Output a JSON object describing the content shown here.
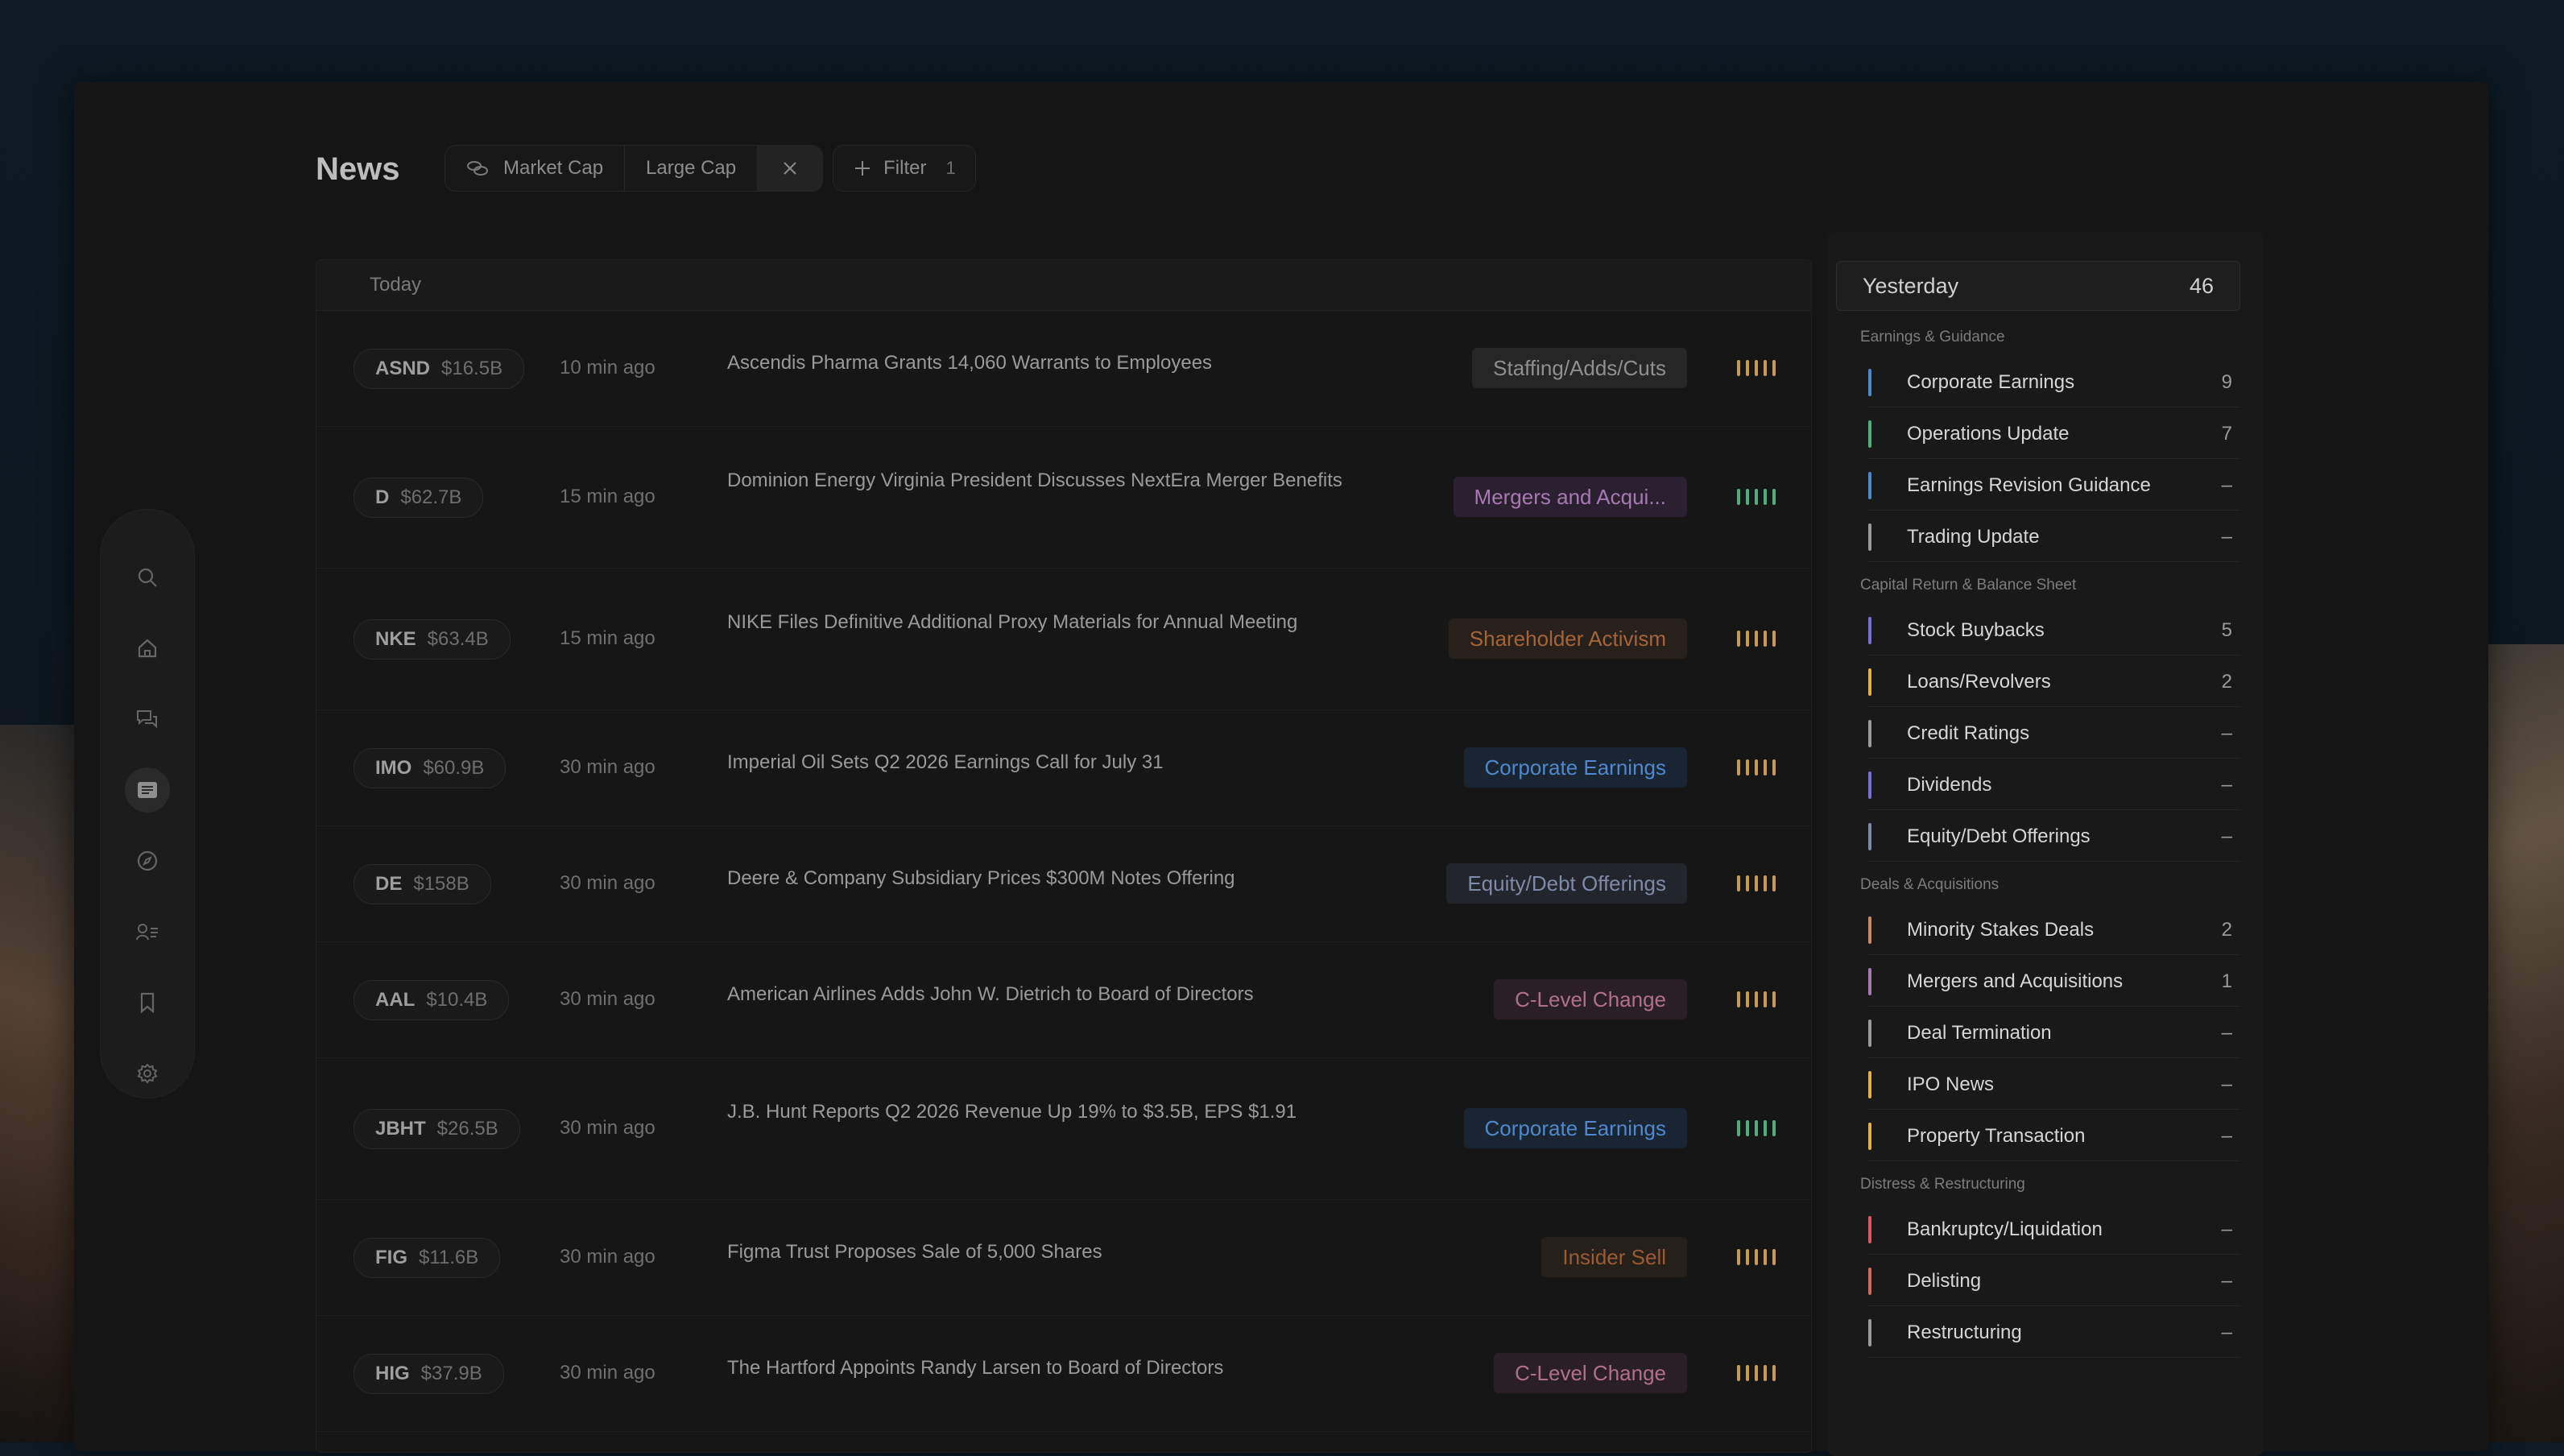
{
  "header": {
    "title": "News",
    "filter_chip": {
      "field": "Market Cap",
      "value": "Large Cap"
    },
    "filter_button": {
      "label": "Filter",
      "count": "1"
    }
  },
  "list": {
    "group_label": "Today",
    "rows": [
      {
        "ticker": "ASND",
        "cap": "$16.5B",
        "time": "10 min ago",
        "headline": "Ascendis Pharma Grants 14,060 Warrants to Employees",
        "tag": "Staffing/Adds/Cuts",
        "tag_color": "#8f8f8f",
        "tag_bg": "#262626",
        "bar_color": "#c99a4e"
      },
      {
        "ticker": "D",
        "cap": "$62.7B",
        "time": "15 min ago",
        "headline": "Dominion Energy Virginia President Discusses NextEra Merger Benefits",
        "tag": "Mergers and Acqui...",
        "tag_color": "#a67ab0",
        "tag_bg": "#2a2030",
        "bar_color": "#4fae7d"
      },
      {
        "ticker": "NKE",
        "cap": "$63.4B",
        "time": "15 min ago",
        "headline": "NIKE Files Definitive Additional Proxy Materials for Annual Meeting",
        "tag": "Shareholder Activism",
        "tag_color": "#a4643a",
        "tag_bg": "#28201a",
        "bar_color": "#c99a4e"
      },
      {
        "ticker": "IMO",
        "cap": "$60.9B",
        "time": "30 min ago",
        "headline": "Imperial Oil Sets Q2 2026 Earnings Call for July 31",
        "tag": "Corporate Earnings",
        "tag_color": "#4f88cc",
        "tag_bg": "#1a2533",
        "bar_color": "#c99a4e"
      },
      {
        "ticker": "DE",
        "cap": "$158B",
        "time": "30 min ago",
        "headline": "Deere & Company Subsidiary Prices $300M Notes Offering",
        "tag": "Equity/Debt Offerings",
        "tag_color": "#7f8aa6",
        "tag_bg": "#22252c",
        "bar_color": "#c99a4e"
      },
      {
        "ticker": "AAL",
        "cap": "$10.4B",
        "time": "30 min ago",
        "headline": "American Airlines Adds John W. Dietrich to Board of Directors",
        "tag": "C-Level Change",
        "tag_color": "#b0708c",
        "tag_bg": "#2a1f25",
        "bar_color": "#c99a4e"
      },
      {
        "ticker": "JBHT",
        "cap": "$26.5B",
        "time": "30 min ago",
        "headline": "J.B. Hunt Reports Q2 2026 Revenue Up 19% to $3.5B, EPS $1.91",
        "tag": "Corporate Earnings",
        "tag_color": "#4f88cc",
        "tag_bg": "#1a2533",
        "bar_color": "#4fae7d"
      },
      {
        "ticker": "FIG",
        "cap": "$11.6B",
        "time": "30 min ago",
        "headline": "Figma Trust Proposes Sale of 5,000 Shares",
        "tag": "Insider Sell",
        "tag_color": "#9a5a36",
        "tag_bg": "#26201a",
        "bar_color": "#c99a4e"
      },
      {
        "ticker": "HIG",
        "cap": "$37.9B",
        "time": "30 min ago",
        "headline": "The Hartford Appoints Randy Larsen to Board of Directors",
        "tag": "C-Level Change",
        "tag_color": "#b0708c",
        "tag_bg": "#2a1f25",
        "bar_color": "#c99a4e"
      }
    ]
  },
  "panel": {
    "title": "Yesterday",
    "total": "46",
    "sections": [
      {
        "label": "Earnings & Guidance",
        "items": [
          {
            "label": "Corporate Earnings",
            "count": "9",
            "color": "#4f88cc"
          },
          {
            "label": "Operations Update",
            "count": "7",
            "color": "#4fae7d"
          },
          {
            "label": "Earnings Revision Guidance",
            "count": "–",
            "color": "#4f88cc"
          },
          {
            "label": "Trading Update",
            "count": "–",
            "color": "#9a9a9a"
          }
        ]
      },
      {
        "label": "Capital Return & Balance Sheet",
        "items": [
          {
            "label": "Stock Buybacks",
            "count": "5",
            "color": "#7a6fd6"
          },
          {
            "label": "Loans/Revolvers",
            "count": "2",
            "color": "#e0b04a"
          },
          {
            "label": "Credit Ratings",
            "count": "–",
            "color": "#9a9a9a"
          },
          {
            "label": "Dividends",
            "count": "–",
            "color": "#7a6fd6"
          },
          {
            "label": "Equity/Debt Offerings",
            "count": "–",
            "color": "#7f8aa6"
          }
        ]
      },
      {
        "label": "Deals & Acquisitions",
        "items": [
          {
            "label": "Minority Stakes Deals",
            "count": "2",
            "color": "#c98a6a"
          },
          {
            "label": "Mergers and Acquisitions",
            "count": "1",
            "color": "#a67ab0"
          },
          {
            "label": "Deal Termination",
            "count": "–",
            "color": "#9a9a9a"
          },
          {
            "label": "IPO News",
            "count": "–",
            "color": "#e0b04a"
          },
          {
            "label": "Property Transaction",
            "count": "–",
            "color": "#e0b04a"
          }
        ]
      },
      {
        "label": "Distress & Restructuring",
        "items": [
          {
            "label": "Bankruptcy/Liquidation",
            "count": "–",
            "color": "#d65a6a"
          },
          {
            "label": "Delisting",
            "count": "–",
            "color": "#d06a5a"
          },
          {
            "label": "Restructuring",
            "count": "–",
            "color": "#9a9a9a"
          }
        ]
      }
    ]
  },
  "nav": {
    "icons": [
      "search-icon",
      "home-icon",
      "chat-icon",
      "news-icon",
      "compass-icon",
      "contacts-icon",
      "bookmark-icon",
      "settings-icon"
    ],
    "active": "news-icon"
  }
}
